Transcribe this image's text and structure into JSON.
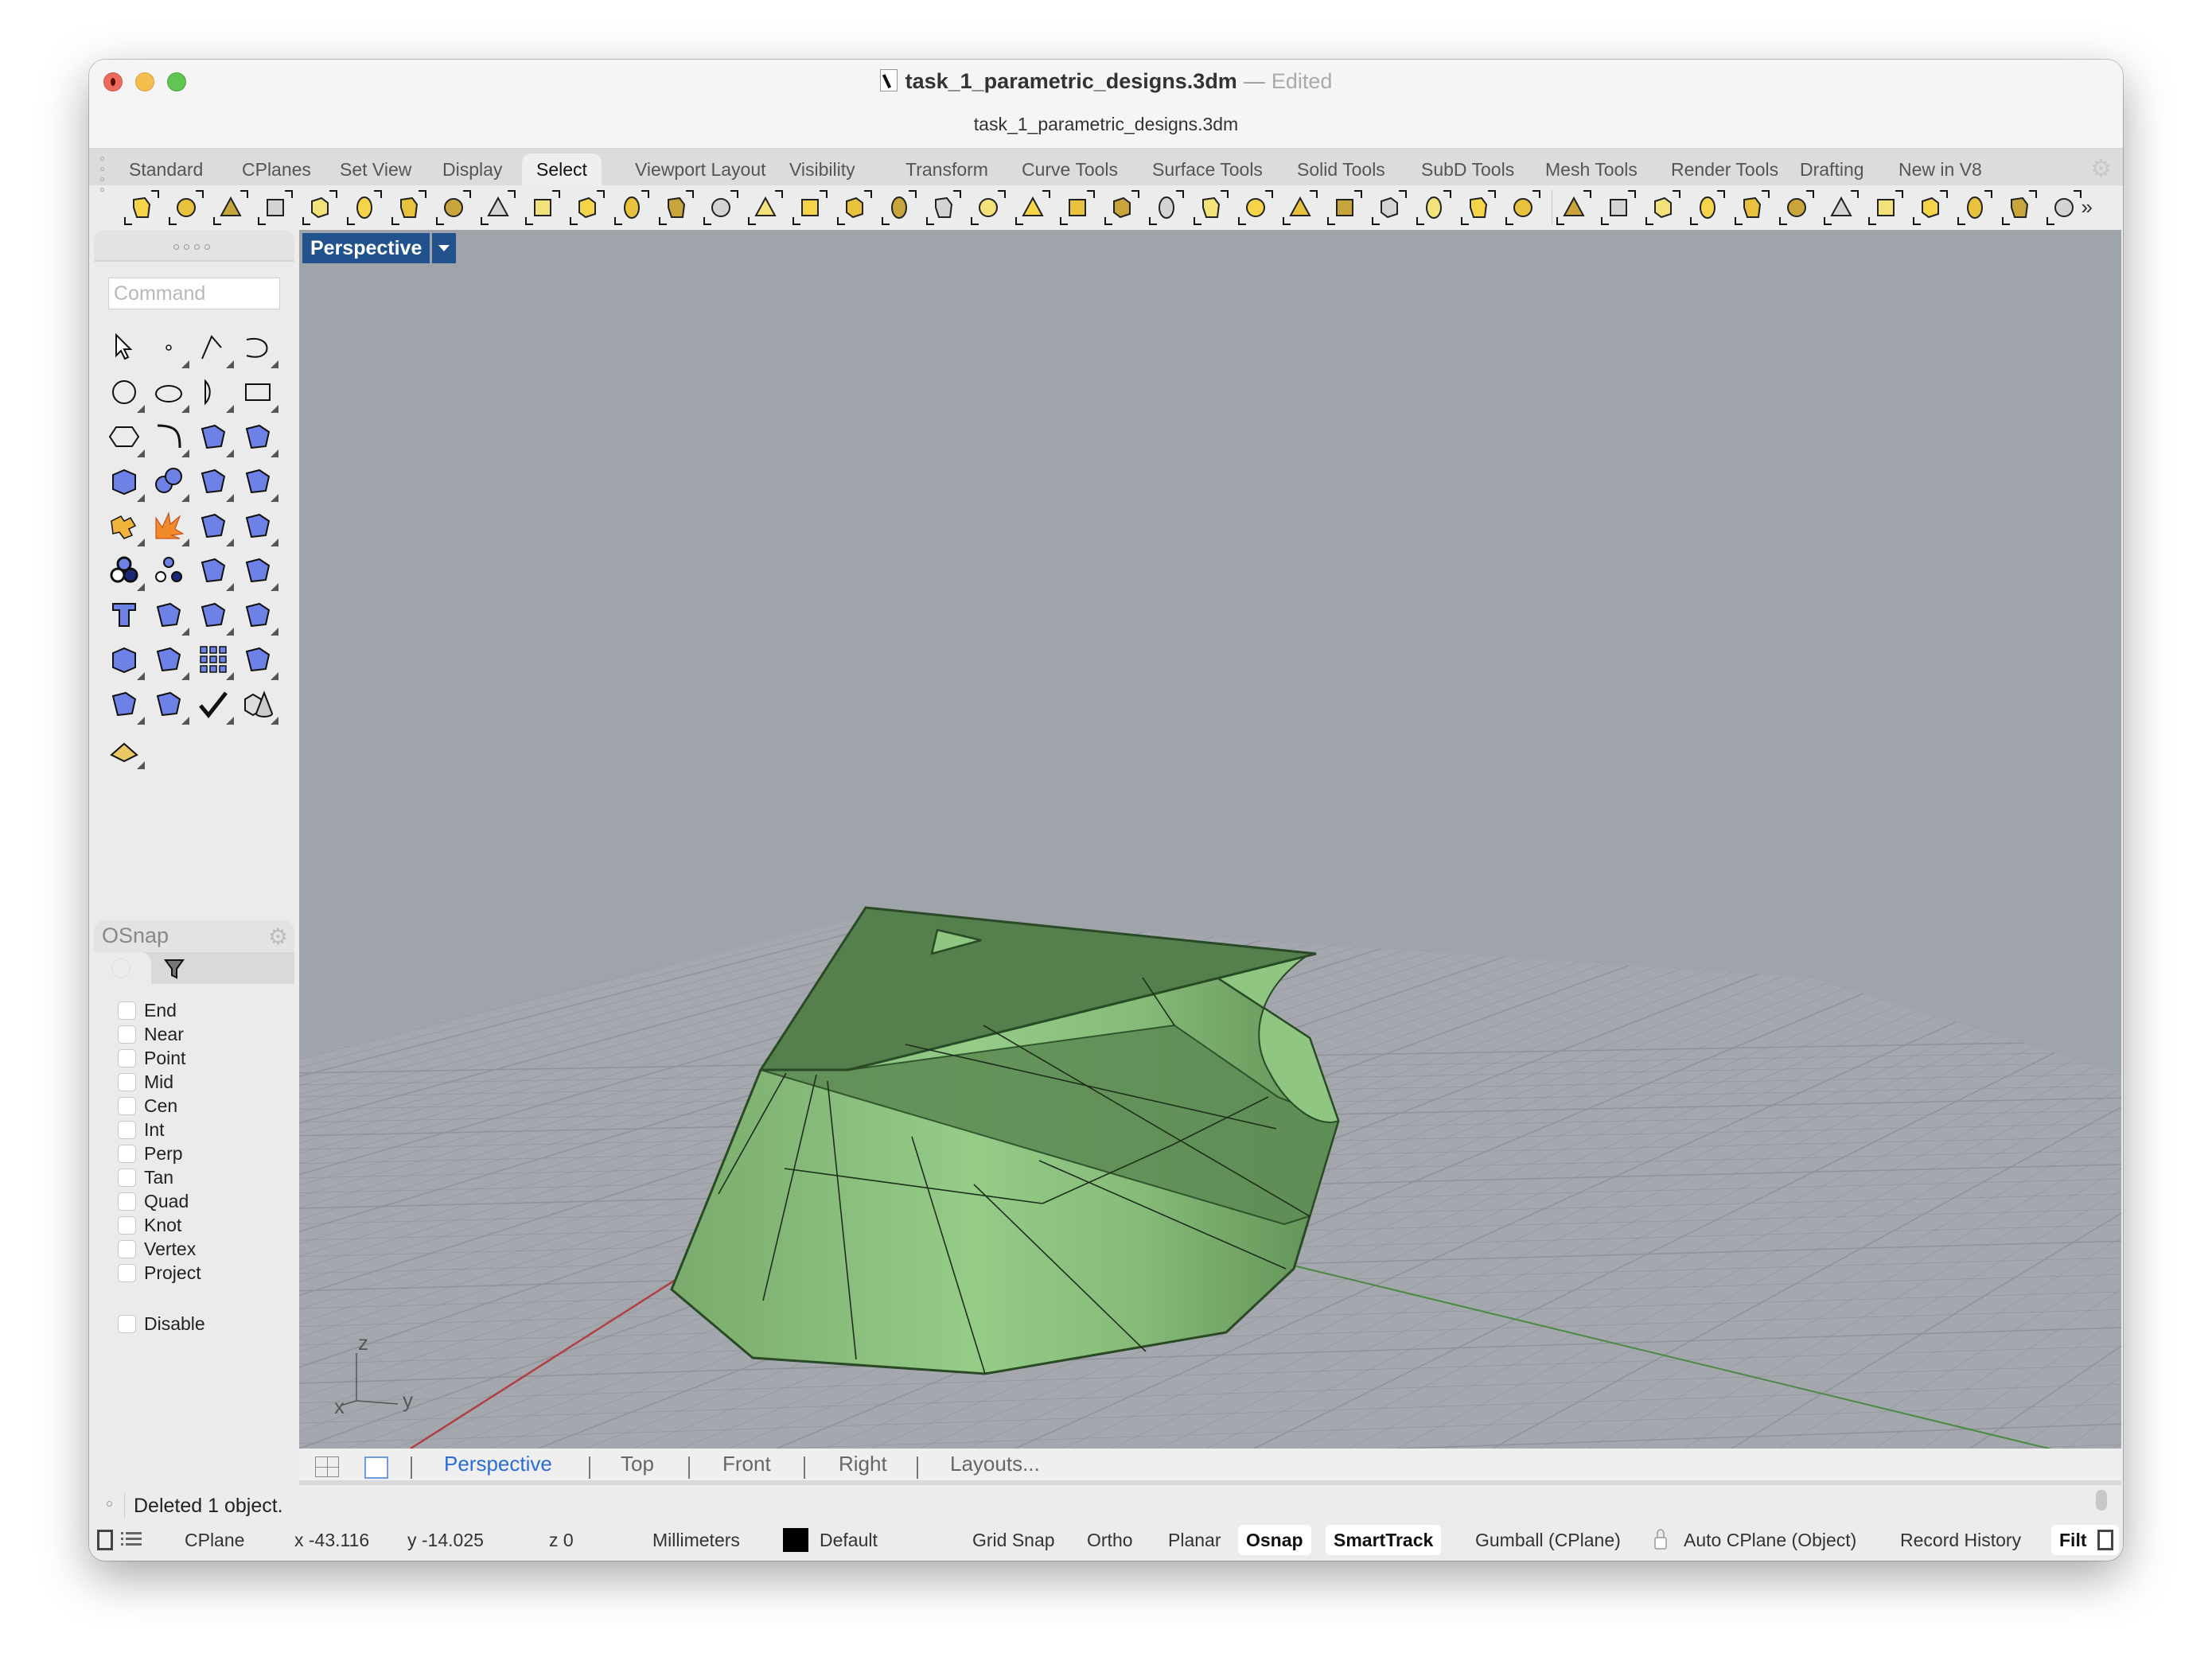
{
  "window": {
    "title": "task_1_parametric_designs.3dm",
    "title_separator": "—",
    "edited_label": "Edited",
    "subtitle": "task_1_parametric_designs.3dm"
  },
  "tabs": [
    {
      "label": "Standard",
      "active": false
    },
    {
      "label": "CPlanes",
      "active": false
    },
    {
      "label": "Set View",
      "active": false
    },
    {
      "label": "Display",
      "active": false
    },
    {
      "label": "Select",
      "active": true
    },
    {
      "label": "Viewport Layout",
      "active": false
    },
    {
      "label": "Visibility",
      "active": false
    },
    {
      "label": "Transform",
      "active": false
    },
    {
      "label": "Curve Tools",
      "active": false
    },
    {
      "label": "Surface Tools",
      "active": false
    },
    {
      "label": "Solid Tools",
      "active": false
    },
    {
      "label": "SubD Tools",
      "active": false
    },
    {
      "label": "Mesh Tools",
      "active": false
    },
    {
      "label": "Render Tools",
      "active": false
    },
    {
      "label": "Drafting",
      "active": false
    },
    {
      "label": "New in V8",
      "active": false
    }
  ],
  "toolbar": {
    "icons": [
      "select-points-icon",
      "deselect-points-icon",
      "selection-filter-icon",
      "invert-selection-icon",
      "select-by-layer-icon",
      "select-last-icon",
      "select-previous-icon",
      "select-by-name-icon",
      "select-by-id-icon",
      "select-duplicates-icon",
      "select-by-color-icon",
      "select-polysurfaces-icon",
      "select-points-cloud-icon",
      "select-point-cloud-icon",
      "select-surfaces-icon",
      "select-open-icon",
      "select-light-icon",
      "select-hatch-icon",
      "select-curves-icon",
      "select-dimensions-icon",
      "select-groups-icon",
      "select-sphere-icon",
      "select-open-polysurface-icon",
      "select-mesh-icon",
      "select-blocks-icon",
      "select-surface-icon",
      "select-grid-surface-icon",
      "select-subd-icon",
      "select-spiral-icon",
      "select-point-cloud-objects-icon",
      "select-chain-icon",
      "select-pyramid-icon",
      "select-window-icon",
      "select-sphere-gray-icon",
      "select-box-icon",
      "select-annotations-icon",
      "select-drops-icon",
      "select-brush-icon",
      "select-zoom-icon",
      "select-fence-icon",
      "select-box-gold-icon",
      "select-box-orange-icon",
      "select-key-icon",
      "select-tag-icon"
    ],
    "more_label": "»"
  },
  "command": {
    "placeholder": "Command",
    "value": ""
  },
  "palette": {
    "icons": [
      "select-arrow-icon",
      "point-icon",
      "polyline-icon",
      "curve-icon",
      "circle-icon",
      "ellipse-icon",
      "arc-icon",
      "rectangle-icon",
      "polygon-icon",
      "fillet-curve-icon",
      "surface-corner-points-icon",
      "extrude-surface-icon",
      "box-icon",
      "boolean-spheres-icon",
      "cylinder-cap-icon",
      "surface-grid-icon",
      "join-icon",
      "explode-icon",
      "trim-icon",
      "split-icon",
      "group-icon",
      "ungroup-icon",
      "curve-edit-icon",
      "offset-curve-icon",
      "text-icon",
      "move-icon",
      "copy-icon",
      "rotate-icon",
      "boolean-difference-icon",
      "extrude-arrows-icon",
      "array-icon",
      "align-icon",
      "mirror-icon",
      "analyze-icon",
      "check-icon",
      "solid-primitives-icon",
      "dimension-pyramid-icon"
    ]
  },
  "osnap": {
    "title": "OSnap",
    "items": [
      {
        "label": "End",
        "checked": false
      },
      {
        "label": "Near",
        "checked": false
      },
      {
        "label": "Point",
        "checked": false
      },
      {
        "label": "Mid",
        "checked": false
      },
      {
        "label": "Cen",
        "checked": false
      },
      {
        "label": "Int",
        "checked": false
      },
      {
        "label": "Perp",
        "checked": false
      },
      {
        "label": "Tan",
        "checked": false
      },
      {
        "label": "Quad",
        "checked": false
      },
      {
        "label": "Knot",
        "checked": false
      },
      {
        "label": "Vertex",
        "checked": false
      },
      {
        "label": "Project",
        "checked": false
      }
    ],
    "disable": {
      "label": "Disable",
      "checked": false
    }
  },
  "viewport": {
    "active_view": "Perspective",
    "background_color": "#9fa3aa",
    "object_color": "#8cbf7f",
    "x_axis_color": "#b04040",
    "y_axis_color": "#4a8a42",
    "axis_labels": {
      "x": "x",
      "y": "y",
      "z": "z"
    }
  },
  "view_tabs": [
    {
      "label": "Perspective",
      "active": true
    },
    {
      "label": "Top",
      "active": false
    },
    {
      "label": "Front",
      "active": false
    },
    {
      "label": "Right",
      "active": false
    },
    {
      "label": "Layouts...",
      "active": false
    }
  ],
  "history": {
    "last_message": "Deleted 1 object."
  },
  "status": {
    "cplane": "CPlane",
    "x": "x -43.116",
    "y": "y -14.025",
    "z": "z 0",
    "units": "Millimeters",
    "layer": "Default",
    "layer_color": "#000000",
    "toggles": [
      {
        "label": "Grid Snap",
        "active": false
      },
      {
        "label": "Ortho",
        "active": false
      },
      {
        "label": "Planar",
        "active": false
      },
      {
        "label": "Osnap",
        "active": true
      },
      {
        "label": "SmartTrack",
        "active": true
      },
      {
        "label": "Gumball (CPlane)",
        "active": false
      },
      {
        "label": "Auto CPlane (Object)",
        "active": false
      },
      {
        "label": "Record History",
        "active": false
      },
      {
        "label": "Filt",
        "active": true
      }
    ]
  }
}
